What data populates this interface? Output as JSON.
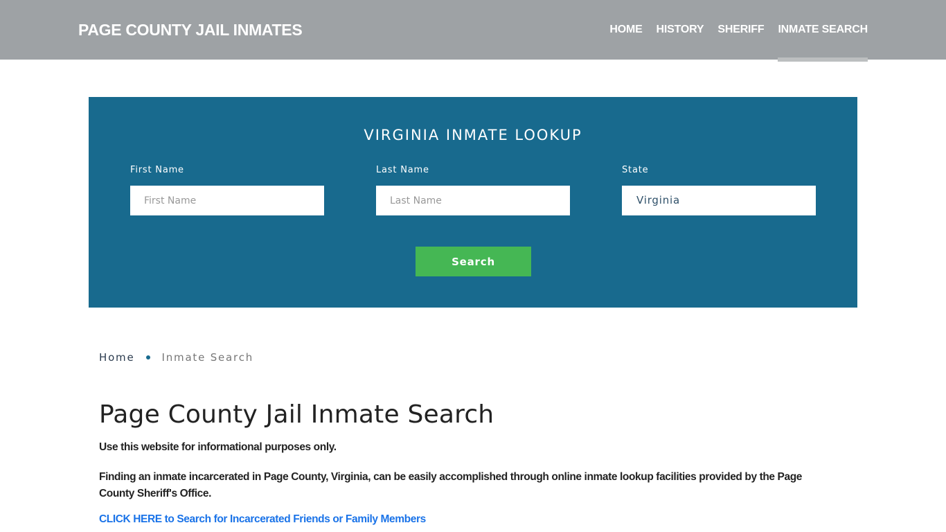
{
  "header": {
    "brand": "PAGE COUNTY JAIL INMATES",
    "nav": [
      {
        "label": "HOME",
        "active": false
      },
      {
        "label": "HISTORY",
        "active": false
      },
      {
        "label": "SHERIFF",
        "active": false
      },
      {
        "label": "INMATE SEARCH",
        "active": true
      }
    ]
  },
  "search_panel": {
    "title": "VIRGINIA INMATE LOOKUP",
    "first_name": {
      "label": "First Name",
      "placeholder": "First Name",
      "value": ""
    },
    "last_name": {
      "label": "Last Name",
      "placeholder": "Last Name",
      "value": ""
    },
    "state": {
      "label": "State",
      "value": "Virginia"
    },
    "search_button": "Search",
    "colors": {
      "panel_bg": "#186a8e",
      "button_bg": "#45b754"
    }
  },
  "breadcrumb": {
    "home": "Home",
    "current": "Inmate Search"
  },
  "main": {
    "title": "Page County Jail Inmate Search",
    "intro": "Use this website for informational purposes only.",
    "paragraph": "Finding an inmate incarcerated in Page County, Virginia, can be easily accomplished through online inmate lookup facilities provided by the Page County Sheriff's Office.",
    "cta_link": "CLICK HERE to Search for Incarcerated Friends or Family Members"
  }
}
